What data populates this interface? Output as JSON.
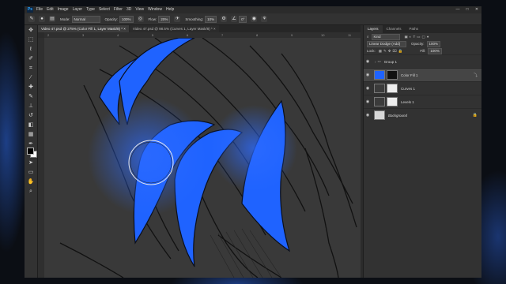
{
  "menu": {
    "app_logo": "Ps",
    "items": [
      "File",
      "Edit",
      "Image",
      "Layer",
      "Type",
      "Select",
      "Filter",
      "3D",
      "View",
      "Window",
      "Help"
    ]
  },
  "window_controls": {
    "minimize": "—",
    "maximize": "□",
    "close": "✕"
  },
  "options_bar": {
    "mode_label": "Mode:",
    "mode_value": "Normal",
    "opacity_label": "Opacity:",
    "opacity_value": "100%",
    "flow_label": "Flow:",
    "flow_value": "20%",
    "smoothing_label": "Smoothing:",
    "smoothing_value": "10%",
    "angle_value": "0°"
  },
  "doc_tabs": [
    {
      "label": "Video 47.psd @ 275% (Color Fill 1, Layer Mask/8) *  ×",
      "active": true
    },
    {
      "label": "Video 47.psd @ 98.5% (Curves 1, Layer Mask/8) *  ×",
      "active": false
    }
  ],
  "ruler": {
    "numbers": [
      "2",
      "3",
      "4",
      "5",
      "6",
      "7",
      "8",
      "9",
      "10",
      "11"
    ]
  },
  "panel": {
    "tabs": [
      "Layers",
      "Channels",
      "Paths"
    ],
    "kind_label": "Kind",
    "blend_mode": "Linear Dodge (Add)",
    "opacity_label": "Opacity:",
    "opacity_value": "100%",
    "lock_label": "Lock:",
    "fill_label": "Fill:",
    "fill_value": "100%",
    "layers": [
      {
        "name": "Group 1",
        "type": "group",
        "selected": false
      },
      {
        "name": "Color Fill 1",
        "type": "fill",
        "selected": true
      },
      {
        "name": "Curves 1",
        "type": "adjust",
        "selected": false
      },
      {
        "name": "Levels 1",
        "type": "adjust",
        "selected": false
      },
      {
        "name": "Background",
        "type": "bg",
        "selected": false
      }
    ]
  },
  "colors": {
    "accent_blue": "#1f63ff",
    "canvas_bg": "#3a3a3a"
  },
  "icons": [
    "move-icon",
    "marquee-icon",
    "lasso-icon",
    "quick-select-icon",
    "crop-icon",
    "eyedropper-icon",
    "healing-icon",
    "brush-icon",
    "stamp-icon",
    "history-brush-icon",
    "eraser-icon",
    "gradient-icon",
    "blur-icon",
    "dodge-icon",
    "pen-icon",
    "type-icon",
    "path-select-icon",
    "shape-icon",
    "hand-icon",
    "zoom-icon"
  ]
}
